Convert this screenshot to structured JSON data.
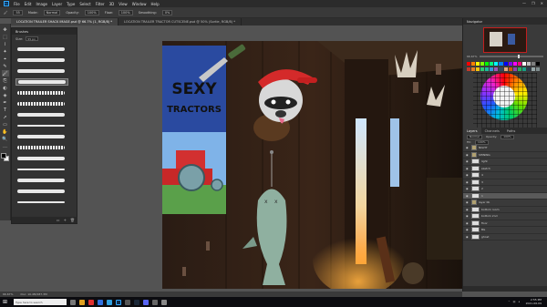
{
  "app": {
    "name": "Photoshop",
    "logo_text": "Ps"
  },
  "menu": [
    "File",
    "Edit",
    "Image",
    "Layer",
    "Type",
    "Select",
    "Filter",
    "3D",
    "View",
    "Window",
    "Help"
  ],
  "window_controls": [
    "—",
    "❐",
    "✕"
  ],
  "options_bar": {
    "size": "55",
    "mode_label": "Mode:",
    "mode": "Normal",
    "opacity_label": "Opacity:",
    "opacity": "100%",
    "flow_label": "Flow:",
    "flow": "100%",
    "smoothing_label": "Smoothing:",
    "smoothing": "0%"
  },
  "doc_tabs": [
    {
      "label": "LOCATION TRAILER SHACK IMAGE.psd @ 66.7% (1, RGB/8) *",
      "active": true
    },
    {
      "label": "LOCATION TRAILER TRACTOR CUTSCENE.psd @ 50% (Sortie, RGB/8) *",
      "active": false
    }
  ],
  "brush_panel": {
    "title": "Brushes",
    "size_label": "Size:",
    "size_value": "55 px",
    "footer_icons": [
      "folder-icon",
      "add-icon",
      "trash-icon"
    ]
  },
  "tools": [
    "✥",
    "⬚",
    "⌇",
    "✦",
    "⌖",
    "✎",
    "🖌",
    "⎘",
    "◐",
    "◈",
    "✒",
    "T",
    "➚",
    "▭",
    "✋",
    "🔍",
    "…"
  ],
  "canvas": {
    "poster_line1": "SEXY",
    "poster_line2": "TRACTORS"
  },
  "navigator": {
    "title": "Navigator",
    "zoom": "66.67%"
  },
  "color_panel": {
    "swatches": [
      "#ff0000",
      "#ff7f00",
      "#ffff00",
      "#7fff00",
      "#00ff00",
      "#00ff7f",
      "#00ffff",
      "#007fff",
      "#0000ff",
      "#7f00ff",
      "#ff00ff",
      "#ff007f",
      "#ffffff",
      "#bfbfbf",
      "#7f7f7f",
      "#000000",
      "#c0392b",
      "#e67e22",
      "#f1c40f",
      "#2ecc71",
      "#1abc9c",
      "#3498db",
      "#9b59b6",
      "#34495e",
      "#e8a87c",
      "#d35400",
      "#8e44ad",
      "#27ae60",
      "#16a085",
      "#2c3e50",
      "#95a5a6",
      "#7f8c8d"
    ]
  },
  "layers": {
    "tabs": [
      "Layers",
      "Channels",
      "Paths"
    ],
    "blend_mode": "Normal",
    "opacity_label": "Opacity:",
    "opacity": "100%",
    "fill_label": "Fill:",
    "fill": "100%",
    "items": [
      {
        "name": "NIGHT",
        "kind": "folder",
        "selected": false
      },
      {
        "name": "SHINING",
        "kind": "folder",
        "selected": false
      },
      {
        "name": "light",
        "kind": "layer",
        "selected": false
      },
      {
        "name": "sketch",
        "kind": "layer",
        "selected": false
      },
      {
        "name": "4",
        "kind": "layer",
        "selected": false
      },
      {
        "name": "3",
        "kind": "layer",
        "selected": false
      },
      {
        "name": "2",
        "kind": "layer",
        "selected": false
      },
      {
        "name": "1",
        "kind": "layer",
        "selected": true
      },
      {
        "name": "layer 0b",
        "kind": "folder",
        "selected": false
      },
      {
        "name": "bottom room",
        "kind": "layer",
        "selected": false
      },
      {
        "name": "bottom 2nd",
        "kind": "layer",
        "selected": false
      },
      {
        "name": "floor",
        "kind": "layer",
        "selected": false
      },
      {
        "name": "BG",
        "kind": "layer",
        "selected": false
      },
      {
        "name": "ghost",
        "kind": "layer",
        "selected": false
      }
    ]
  },
  "status_bar": {
    "zoom": "66.67%",
    "doc_size": "Doc: 10.4M/187.3M"
  },
  "taskbar": {
    "search_placeholder": "Type here to search",
    "time": "2:55 PM",
    "date": "2021-06-09"
  }
}
